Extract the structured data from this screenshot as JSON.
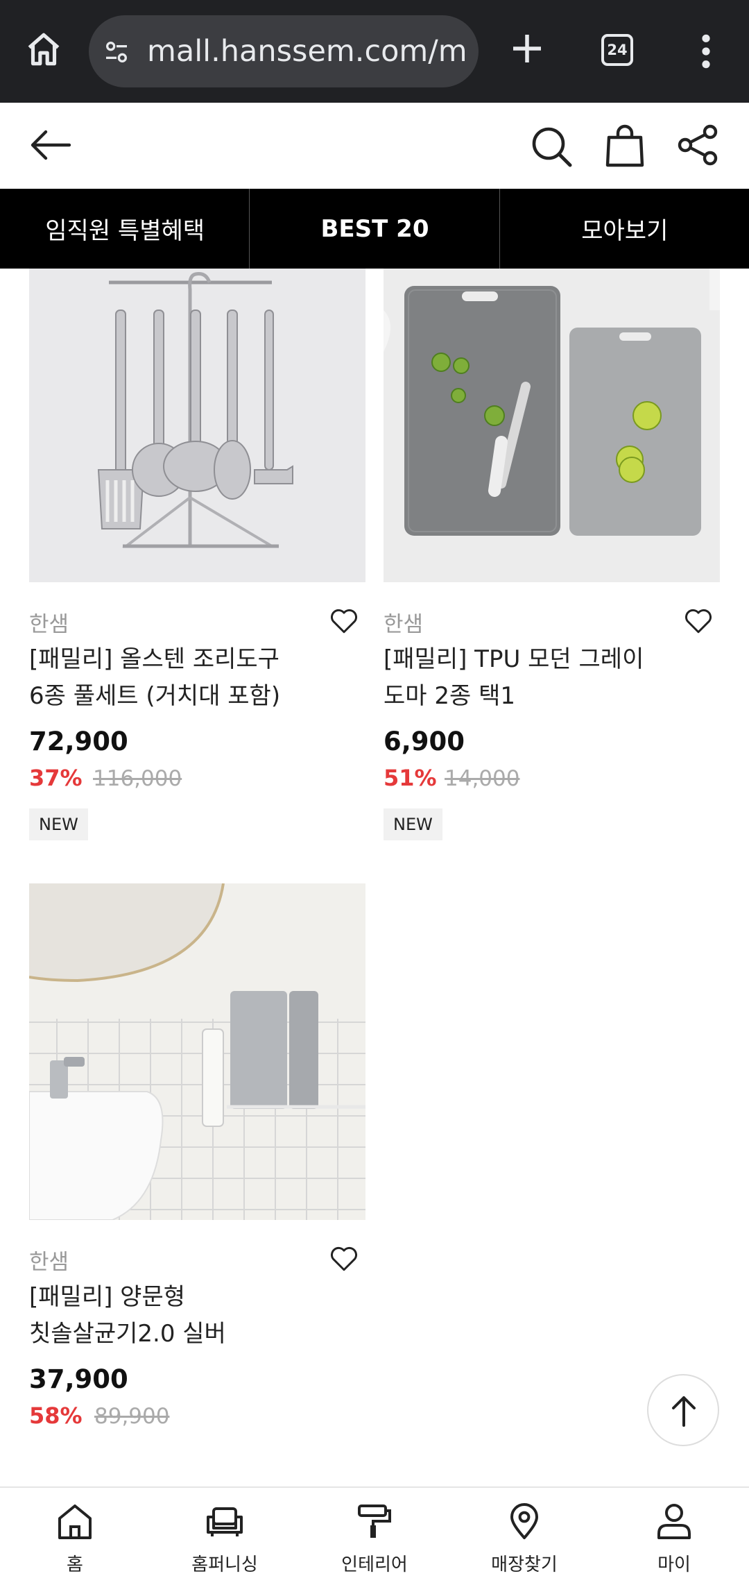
{
  "browser": {
    "url": "mall.hanssem.com/m/",
    "tab_count": "24"
  },
  "category_tabs": [
    {
      "label": "임직원 특별혜택",
      "active": false
    },
    {
      "label": "BEST 20",
      "active": true
    },
    {
      "label": "모아보기",
      "active": false
    }
  ],
  "products": [
    {
      "brand": "한샘",
      "name_line1": "[패밀리] 올스텐 조리도구",
      "name_line2": "6종 풀세트 (거치대 포함)",
      "price": "72,900",
      "discount": "37%",
      "original_price": "116,000",
      "badge": "NEW"
    },
    {
      "brand": "한샘",
      "name_line1": "[패밀리] TPU 모던 그레이",
      "name_line2": "도마 2종 택1",
      "price": "6,900",
      "discount": "51%",
      "original_price": "14,000",
      "badge": "NEW"
    },
    {
      "brand": "한샘",
      "name_line1": "[패밀리] 양문형",
      "name_line2": "칫솔살균기2.0 실버",
      "price": "37,900",
      "discount": "58%",
      "original_price": "89,900"
    }
  ],
  "bottom_nav": [
    {
      "label": "홈",
      "icon": "home-icon"
    },
    {
      "label": "홈퍼니싱",
      "icon": "sofa-icon"
    },
    {
      "label": "인테리어",
      "icon": "paint-roller-icon"
    },
    {
      "label": "매장찾기",
      "icon": "location-pin-icon"
    },
    {
      "label": "마이",
      "icon": "person-icon"
    }
  ],
  "colors": {
    "discount": "#e5393a",
    "browser_bar": "#202124",
    "tabs_bg": "#000000"
  }
}
